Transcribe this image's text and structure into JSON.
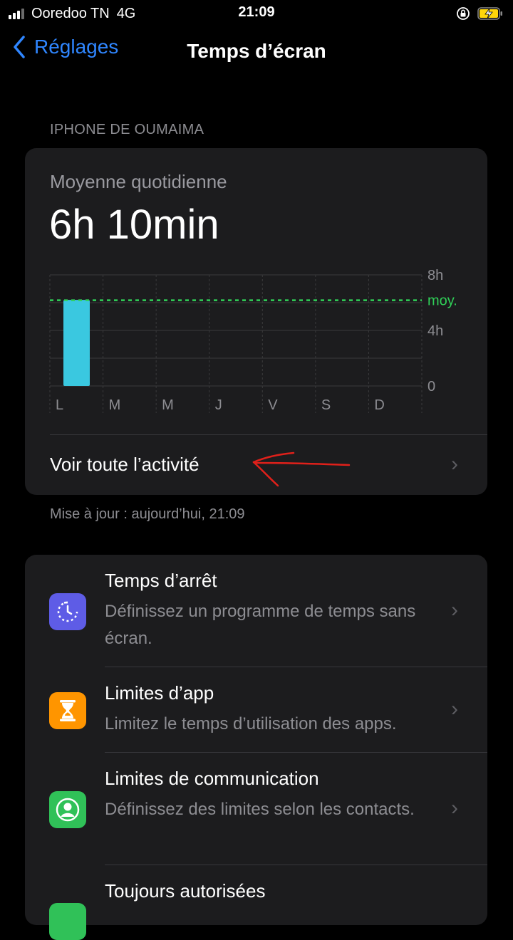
{
  "status_bar": {
    "carrier": "Ooredoo TN",
    "network": "4G",
    "time": "21:09"
  },
  "nav": {
    "back_label": "Réglages",
    "title": "Temps d’écran"
  },
  "device_header": "IPHONE DE OUMAIMA",
  "summary": {
    "label": "Moyenne quotidienne",
    "value": "6h 10min"
  },
  "chart_data": {
    "type": "bar",
    "categories": [
      "L",
      "M",
      "M",
      "J",
      "V",
      "S",
      "D"
    ],
    "values": [
      6.2,
      0,
      0,
      0,
      0,
      0,
      0
    ],
    "average": 6.17,
    "y_ticks": [
      "8h",
      "4h",
      "0"
    ],
    "average_label": "moy.",
    "ylim": [
      0,
      8
    ],
    "bar_color": "#3ac8e0",
    "average_color": "#30d158"
  },
  "see_all_label": "Voir toute l’activité",
  "updated_text": "Mise à jour : aujourd’hui, 21:09",
  "settings_rows": [
    {
      "title": "Temps d’arrêt",
      "subtitle": "Définissez un programme de temps sans écran.",
      "icon": "downtime-icon",
      "color": "#5e5ce6"
    },
    {
      "title": "Limites d’app",
      "subtitle": "Limitez le temps d’utilisation des apps.",
      "icon": "hourglass-icon",
      "color": "#ff9500"
    },
    {
      "title": "Limites de communication",
      "subtitle": "Définissez des limites selon les contacts.",
      "icon": "contact-icon",
      "color": "#30c158"
    },
    {
      "title": "Toujours autorisées",
      "subtitle": "",
      "icon": "checkmark-icon",
      "color": "#30c158"
    }
  ],
  "colors": {
    "accent": "#2f86ff",
    "card_bg": "#1c1c1e",
    "secondary_text": "#8d8d92"
  }
}
